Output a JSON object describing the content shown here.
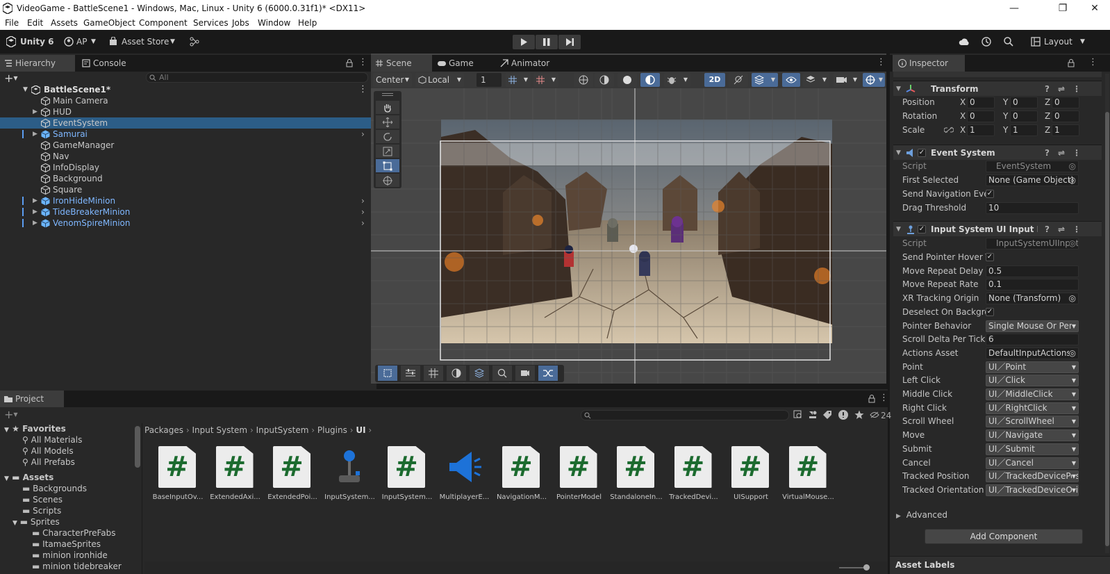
{
  "window": {
    "title": "VideoGame - BattleScene1 - Windows, Mac, Linux - Unity 6 (6000.0.31f1)* <DX11>",
    "minimize": "—",
    "maximize": "❐",
    "close": "✕"
  },
  "menu": [
    "File",
    "Edit",
    "Assets",
    "GameObject",
    "Component",
    "Services",
    "Jobs",
    "Window",
    "Help"
  ],
  "toolbar": {
    "unity_label": "Unity 6",
    "account": "AP",
    "asset_store": "Asset Store",
    "layout": "Layout"
  },
  "hierarchy": {
    "tab": "Hierarchy",
    "console_tab": "Console",
    "search_placeholder": "All",
    "scene_name": "BattleScene1*",
    "items": [
      {
        "name": "Main Camera",
        "prefab": false,
        "arrow": false,
        "selected": false
      },
      {
        "name": "HUD",
        "prefab": false,
        "arrow": true,
        "selected": false
      },
      {
        "name": "EventSystem",
        "prefab": false,
        "arrow": false,
        "selected": true
      },
      {
        "name": "Samurai",
        "prefab": true,
        "arrow": true,
        "selected": false
      },
      {
        "name": "GameManager",
        "prefab": false,
        "arrow": false,
        "selected": false
      },
      {
        "name": "Nav",
        "prefab": false,
        "arrow": false,
        "selected": false
      },
      {
        "name": "InfoDisplay",
        "prefab": false,
        "arrow": false,
        "selected": false
      },
      {
        "name": "Background",
        "prefab": false,
        "arrow": false,
        "selected": false
      },
      {
        "name": "Square",
        "prefab": false,
        "arrow": false,
        "selected": false
      },
      {
        "name": "IronHideMinion",
        "prefab": true,
        "arrow": true,
        "selected": false
      },
      {
        "name": "TideBreakerMinion",
        "prefab": true,
        "arrow": true,
        "selected": false
      },
      {
        "name": "VenomSpireMinion",
        "prefab": true,
        "arrow": true,
        "selected": false
      }
    ]
  },
  "scene": {
    "tabs": [
      "Scene",
      "Game",
      "Animator"
    ],
    "pivot": "Center",
    "space": "Local",
    "grid_size": "1",
    "mode_2d": "2D"
  },
  "inspector": {
    "tab": "Inspector",
    "transform": {
      "title": "Transform",
      "position_label": "Position",
      "rotation_label": "Rotation",
      "scale_label": "Scale",
      "axis_x": "X",
      "axis_y": "Y",
      "axis_z": "Z",
      "position": [
        "0",
        "0",
        "0"
      ],
      "rotation": [
        "0",
        "0",
        "0"
      ],
      "scale": [
        "1",
        "1",
        "1"
      ]
    },
    "event_system": {
      "title": "Event System",
      "script_label": "Script",
      "script_value": "EventSystem",
      "first_selected_label": "First Selected",
      "first_selected_value": "None (Game Object)",
      "send_nav_label": "Send Navigation Events",
      "drag_threshold_label": "Drag Threshold",
      "drag_threshold_value": "10"
    },
    "input_module": {
      "title": "Input System UI Input Module",
      "script_label": "Script",
      "script_value": "InputSystemUIInputModule",
      "rows": [
        {
          "label": "Send Pointer Hover To Parent",
          "type": "check"
        },
        {
          "label": "Move Repeat Delay",
          "type": "text",
          "value": "0.5"
        },
        {
          "label": "Move Repeat Rate",
          "type": "text",
          "value": "0.1"
        },
        {
          "label": "XR Tracking Origin",
          "type": "obj",
          "value": "None (Transform)"
        },
        {
          "label": "Deselect On Background Click",
          "type": "check"
        },
        {
          "label": "Pointer Behavior",
          "type": "dd",
          "value": "Single Mouse Or Pen"
        },
        {
          "label": "Scroll Delta Per Tick",
          "type": "text",
          "value": "6"
        },
        {
          "label": "Actions Asset",
          "type": "obj",
          "value": "DefaultInputActions"
        },
        {
          "label": "Point",
          "type": "dd",
          "value": "UI／Point"
        },
        {
          "label": "Left Click",
          "type": "dd",
          "value": "UI／Click"
        },
        {
          "label": "Middle Click",
          "type": "dd",
          "value": "UI／MiddleClick"
        },
        {
          "label": "Right Click",
          "type": "dd",
          "value": "UI／RightClick"
        },
        {
          "label": "Scroll Wheel",
          "type": "dd",
          "value": "UI／ScrollWheel"
        },
        {
          "label": "Move",
          "type": "dd",
          "value": "UI／Navigate"
        },
        {
          "label": "Submit",
          "type": "dd",
          "value": "UI／Submit"
        },
        {
          "label": "Cancel",
          "type": "dd",
          "value": "UI／Cancel"
        },
        {
          "label": "Tracked Position",
          "type": "dd",
          "value": "UI／TrackedDevicePosition"
        },
        {
          "label": "Tracked Orientation",
          "type": "dd",
          "value": "UI／TrackedDeviceOrientation"
        }
      ],
      "advanced": "Advanced"
    },
    "add_component": "Add Component",
    "asset_labels": "Asset Labels"
  },
  "project": {
    "tab": "Project",
    "count": "24",
    "breadcrumb": [
      "Packages",
      "Input System",
      "InputSystem",
      "Plugins",
      "UI"
    ],
    "favorites": {
      "label": "Favorites",
      "items": [
        "All Materials",
        "All Models",
        "All Prefabs"
      ]
    },
    "assets": {
      "label": "Assets",
      "items": [
        "Backgrounds",
        "Scenes",
        "Scripts"
      ]
    },
    "sprites": {
      "label": "Sprites",
      "items": [
        "CharacterPreFabs",
        "ItamaeSprites",
        "minion ironhide",
        "minion tidebreaker"
      ]
    },
    "files": [
      {
        "name": "BaseInputOv...",
        "kind": "script"
      },
      {
        "name": "ExtendedAxi...",
        "kind": "script"
      },
      {
        "name": "ExtendedPoi...",
        "kind": "script"
      },
      {
        "name": "InputSystem...",
        "kind": "joystick"
      },
      {
        "name": "InputSystem...",
        "kind": "script"
      },
      {
        "name": "MultiplayerE...",
        "kind": "megaphone"
      },
      {
        "name": "NavigationM...",
        "kind": "script"
      },
      {
        "name": "PointerModel",
        "kind": "script"
      },
      {
        "name": "StandaloneIn...",
        "kind": "script"
      },
      {
        "name": "TrackedDevi...",
        "kind": "script"
      },
      {
        "name": "UISupport",
        "kind": "script"
      },
      {
        "name": "VirtualMouse...",
        "kind": "script"
      }
    ]
  }
}
